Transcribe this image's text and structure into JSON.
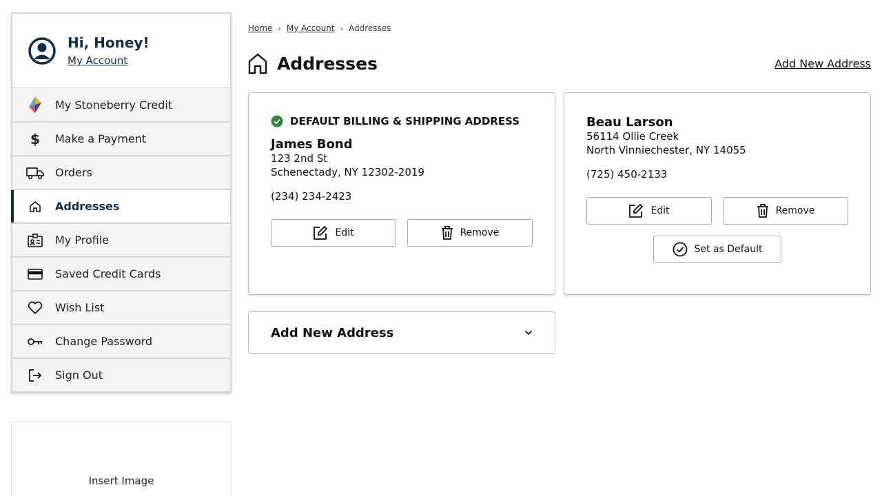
{
  "sidebar": {
    "greeting": "Hi, Honey!",
    "account_link": "My Account",
    "items": [
      {
        "label": "My Stoneberry Credit",
        "icon": "stoneberry-logo-icon"
      },
      {
        "label": "Make a Payment",
        "icon": "dollar-icon"
      },
      {
        "label": "Orders",
        "icon": "truck-icon"
      },
      {
        "label": "Addresses",
        "icon": "home-icon",
        "active": true
      },
      {
        "label": "My Profile",
        "icon": "profile-badge-icon"
      },
      {
        "label": "Saved Credit Cards",
        "icon": "credit-card-icon"
      },
      {
        "label": "Wish List",
        "icon": "heart-icon"
      },
      {
        "label": "Change Password",
        "icon": "key-icon"
      },
      {
        "label": "Sign Out",
        "icon": "sign-out-icon"
      }
    ]
  },
  "promo": {
    "text": "Insert Image"
  },
  "breadcrumb": [
    "Home",
    "My Account",
    "Addresses"
  ],
  "page": {
    "title": "Addresses",
    "add_link": "Add New Address"
  },
  "addresses": [
    {
      "default_label": "DEFAULT BILLING & SHIPPING ADDRESS",
      "name": "James Bond",
      "line1": "123 2nd St",
      "line2": "Schenectady, NY 12302-2019",
      "phone": "(234) 234-2423",
      "edit": "Edit",
      "remove": "Remove"
    },
    {
      "name": "Beau Larson",
      "line1": "56114 Ollie Creek",
      "line2": "North Vinniechester, NY 14055",
      "phone": "(725) 450-2133",
      "edit": "Edit",
      "remove": "Remove",
      "set_default": "Set as Default"
    }
  ],
  "add_panel": {
    "label": "Add New Address"
  },
  "colors": {
    "navy": "#0f2e4a",
    "check_green": "#2e8b3a"
  }
}
